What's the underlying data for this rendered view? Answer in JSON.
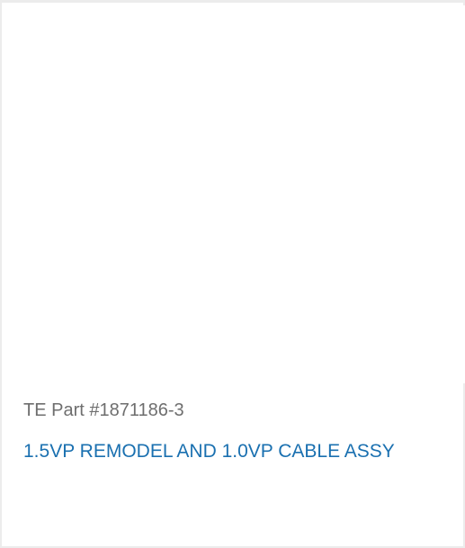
{
  "product": {
    "part_number": "TE Part #1871186-3",
    "title": "1.5VP REMODEL AND 1.0VP CABLE ASSY"
  },
  "colors": {
    "part_number_text": "#6e6e6e",
    "title_link": "#1a70b0",
    "border": "#ececec",
    "background": "#ffffff"
  }
}
